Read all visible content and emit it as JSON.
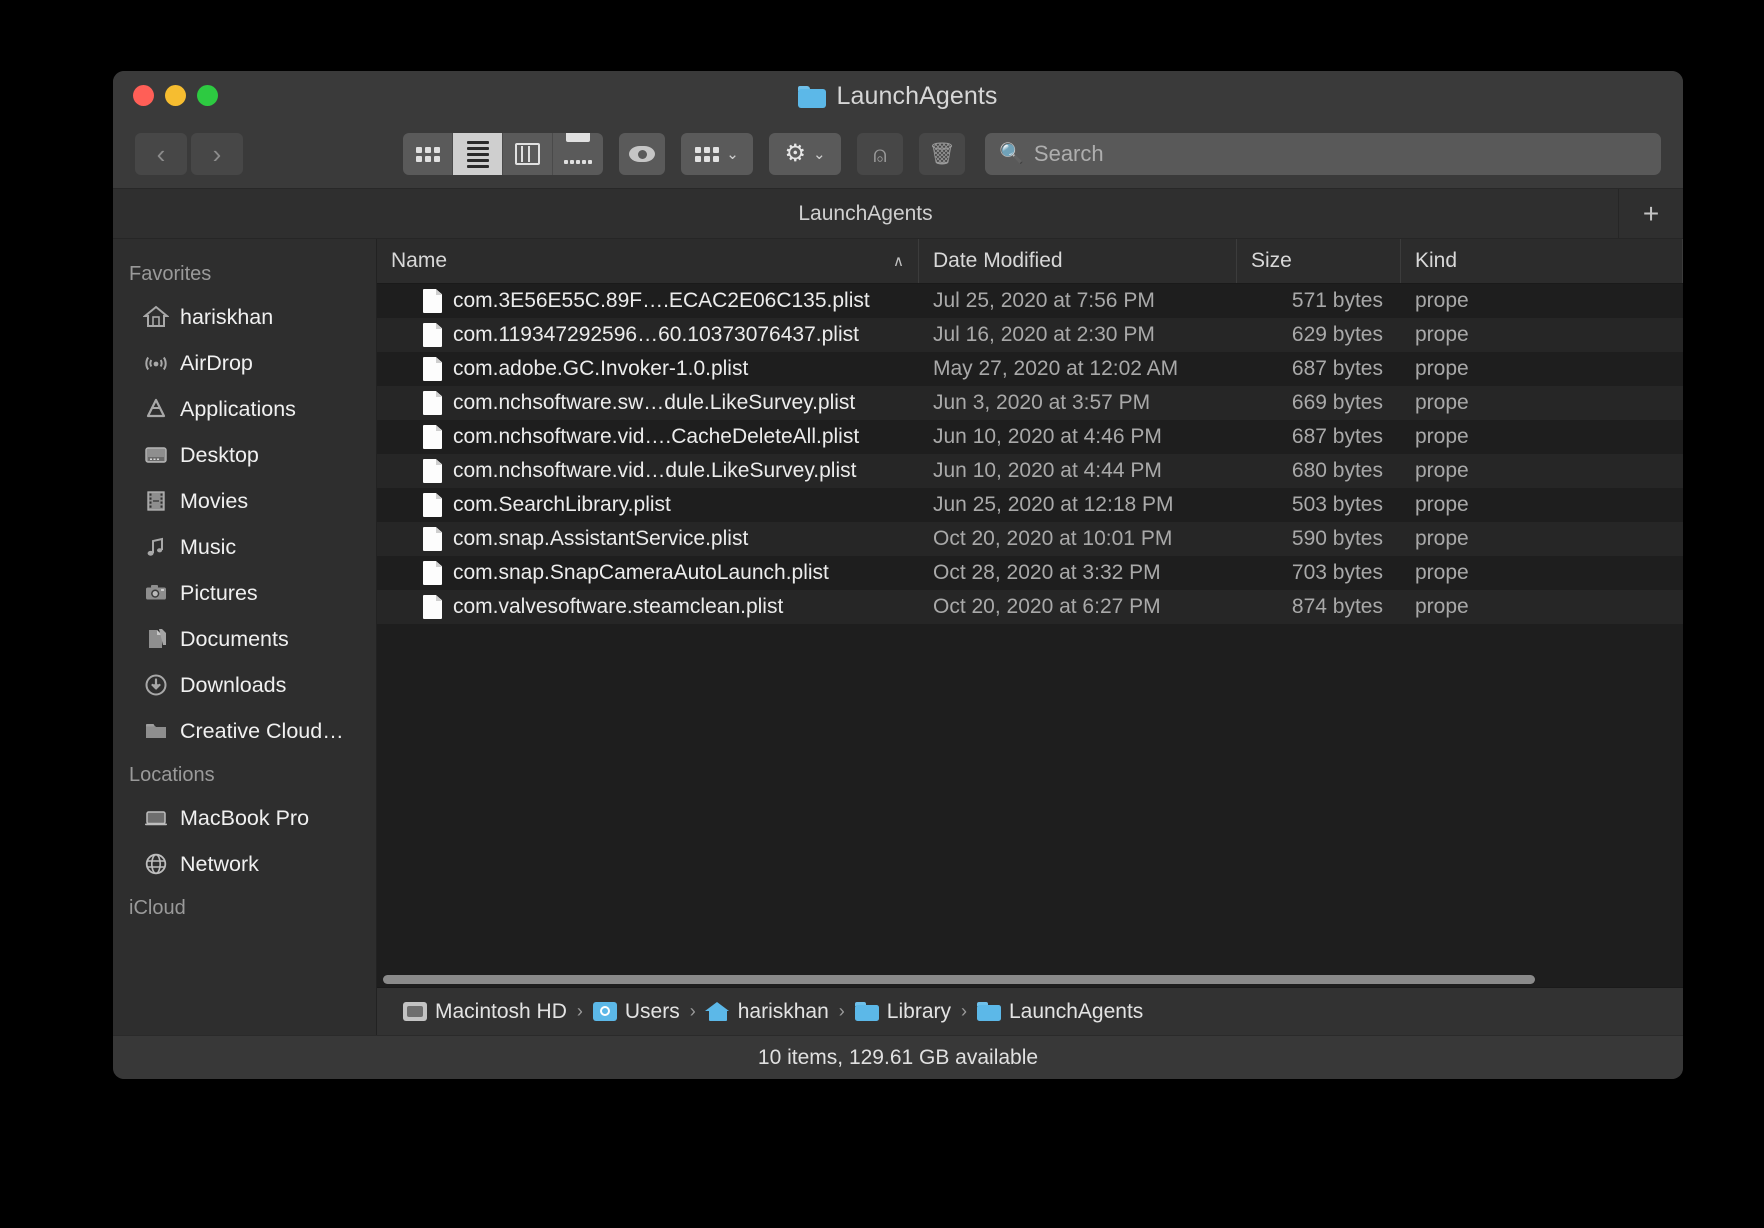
{
  "window": {
    "title": "LaunchAgents",
    "traffic_lights": {
      "close": "close",
      "minimize": "minimize",
      "zoom": "zoom"
    }
  },
  "toolbar": {
    "back_label": "‹",
    "forward_label": "›",
    "view_icon": "icon-view",
    "view_list": "list-view",
    "view_columns": "column-view",
    "view_gallery": "gallery-view",
    "quicklook_label": "quick-look",
    "group_label": "group-by",
    "action_label": "action-gear",
    "share_label": "share",
    "delete_label": "delete",
    "caret": "⌄"
  },
  "search": {
    "placeholder": "Search",
    "value": ""
  },
  "tabbar": {
    "tab_label": "LaunchAgents",
    "add_label": "+"
  },
  "sidebar": {
    "sections": [
      {
        "header": "Favorites",
        "items": [
          {
            "label": "hariskhan",
            "icon": "home-icon"
          },
          {
            "label": "AirDrop",
            "icon": "airdrop-icon"
          },
          {
            "label": "Applications",
            "icon": "applications-icon"
          },
          {
            "label": "Desktop",
            "icon": "desktop-icon"
          },
          {
            "label": "Movies",
            "icon": "movies-icon"
          },
          {
            "label": "Music",
            "icon": "music-icon"
          },
          {
            "label": "Pictures",
            "icon": "pictures-icon"
          },
          {
            "label": "Documents",
            "icon": "documents-icon"
          },
          {
            "label": "Downloads",
            "icon": "downloads-icon"
          },
          {
            "label": "Creative Cloud…",
            "icon": "folder-icon"
          }
        ]
      },
      {
        "header": "Locations",
        "items": [
          {
            "label": "MacBook Pro",
            "icon": "laptop-icon"
          },
          {
            "label": "Network",
            "icon": "network-icon"
          }
        ]
      },
      {
        "header": "iCloud",
        "items": []
      }
    ]
  },
  "filelist": {
    "columns": [
      {
        "key": "name",
        "label": "Name",
        "sorted": true,
        "sort_arrow": "∧"
      },
      {
        "key": "date",
        "label": "Date Modified"
      },
      {
        "key": "size",
        "label": "Size"
      },
      {
        "key": "kind",
        "label": "Kind"
      }
    ],
    "rows": [
      {
        "name": "com.3E56E55C.89F….ECAC2E06C135.plist",
        "date": "Jul 25, 2020 at 7:56 PM",
        "size": "571 bytes",
        "kind": "prope"
      },
      {
        "name": "com.119347292596…60.10373076437.plist",
        "date": "Jul 16, 2020 at 2:30 PM",
        "size": "629 bytes",
        "kind": "prope"
      },
      {
        "name": "com.adobe.GC.Invoker-1.0.plist",
        "date": "May 27, 2020 at 12:02 AM",
        "size": "687 bytes",
        "kind": "prope"
      },
      {
        "name": "com.nchsoftware.sw…dule.LikeSurvey.plist",
        "date": "Jun 3, 2020 at 3:57 PM",
        "size": "669 bytes",
        "kind": "prope"
      },
      {
        "name": "com.nchsoftware.vid….CacheDeleteAll.plist",
        "date": "Jun 10, 2020 at 4:46 PM",
        "size": "687 bytes",
        "kind": "prope"
      },
      {
        "name": "com.nchsoftware.vid…dule.LikeSurvey.plist",
        "date": "Jun 10, 2020 at 4:44 PM",
        "size": "680 bytes",
        "kind": "prope"
      },
      {
        "name": "com.SearchLibrary.plist",
        "date": "Jun 25, 2020 at 12:18 PM",
        "size": "503 bytes",
        "kind": "prope"
      },
      {
        "name": "com.snap.AssistantService.plist",
        "date": "Oct 20, 2020 at 10:01 PM",
        "size": "590 bytes",
        "kind": "prope"
      },
      {
        "name": "com.snap.SnapCameraAutoLaunch.plist",
        "date": "Oct 28, 2020 at 3:32 PM",
        "size": "703 bytes",
        "kind": "prope"
      },
      {
        "name": "com.valvesoftware.steamclean.plist",
        "date": "Oct 20, 2020 at 6:27 PM",
        "size": "874 bytes",
        "kind": "prope"
      }
    ]
  },
  "pathbar": {
    "crumbs": [
      {
        "label": "Macintosh HD",
        "icon": "harddisk-icon"
      },
      {
        "label": "Users",
        "icon": "users-folder-icon"
      },
      {
        "label": "hariskhan",
        "icon": "home-folder-icon"
      },
      {
        "label": "Library",
        "icon": "folder-icon"
      },
      {
        "label": "LaunchAgents",
        "icon": "folder-icon"
      }
    ],
    "separator": "›"
  },
  "statusbar": {
    "text": "10 items, 129.61 GB available"
  },
  "colors": {
    "window_bg": "#323232",
    "sidebar_bg": "#2e2e2e",
    "list_bg": "#1e1e1e",
    "row_alt_bg": "#262626",
    "accent_folder": "#5cb8e8",
    "close": "#ff5f57",
    "minimize": "#f6bd30",
    "zoom": "#2dca41"
  }
}
